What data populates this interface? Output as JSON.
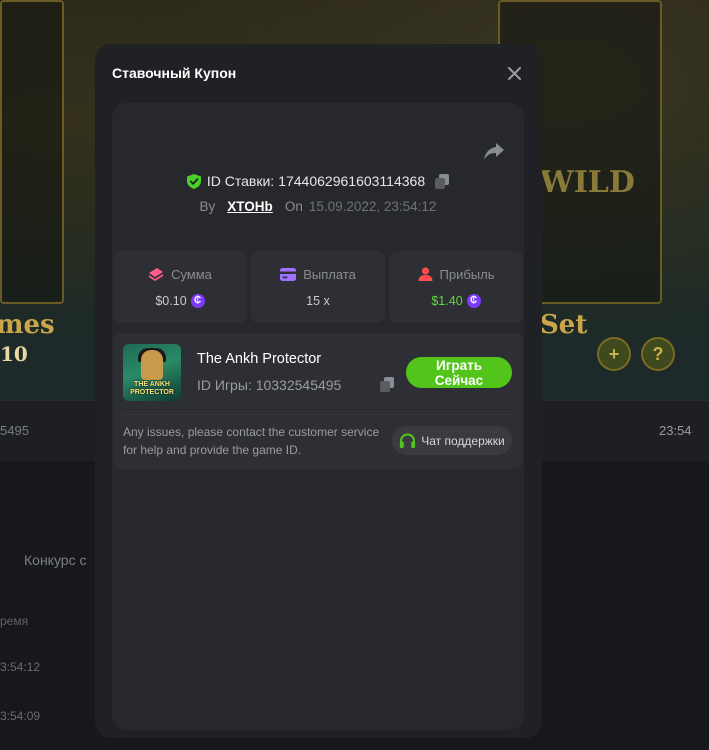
{
  "background": {
    "game_word_left": "mes",
    "game_word_right": "Set",
    "game_value_left": "10",
    "wild_label": "WILD",
    "row_id_fragment": "5495",
    "row_time_right": "23:54",
    "contest_fragment": "Конкурс с",
    "column_header_fragment": "ремя",
    "row_time_1": "3:54:12",
    "row_time_2": "3:54:09"
  },
  "modal": {
    "title": "Ставочный Купон",
    "bet_id_label": "ID Ставки:",
    "bet_id_value": "1744062961603114368",
    "by_label": "By",
    "username": "XTOHb",
    "on_label": "On",
    "date": "15.09.2022, 23:54:12",
    "stats": [
      {
        "label": "Сумма",
        "value": "$0.10",
        "icon": "wager-icon",
        "coin": true,
        "color": "#ff5b8a"
      },
      {
        "label": "Выплата",
        "value": "15 x",
        "icon": "payout-card-icon",
        "coin": false,
        "color": "#a070ff"
      },
      {
        "label": "Прибыль",
        "value": "$1.40",
        "icon": "profit-user-icon",
        "coin": true,
        "color": "#ff4d4f"
      }
    ],
    "game": {
      "name": "The Ankh Protector",
      "id_label": "ID Игры:",
      "id_value": "10332545495",
      "thumb_text": "THE ANKH PROTECTOR",
      "play_label": "Играть Сейчас"
    },
    "support": {
      "text": "Any issues, please contact the customer service for help and provide the game ID.",
      "button_label": "Чат поддержки"
    },
    "colors": {
      "accent_green": "#52c41a",
      "profit_green": "#5fdc3a",
      "coin_purple": "#7b3cff",
      "verified_green": "#49d12a"
    }
  }
}
